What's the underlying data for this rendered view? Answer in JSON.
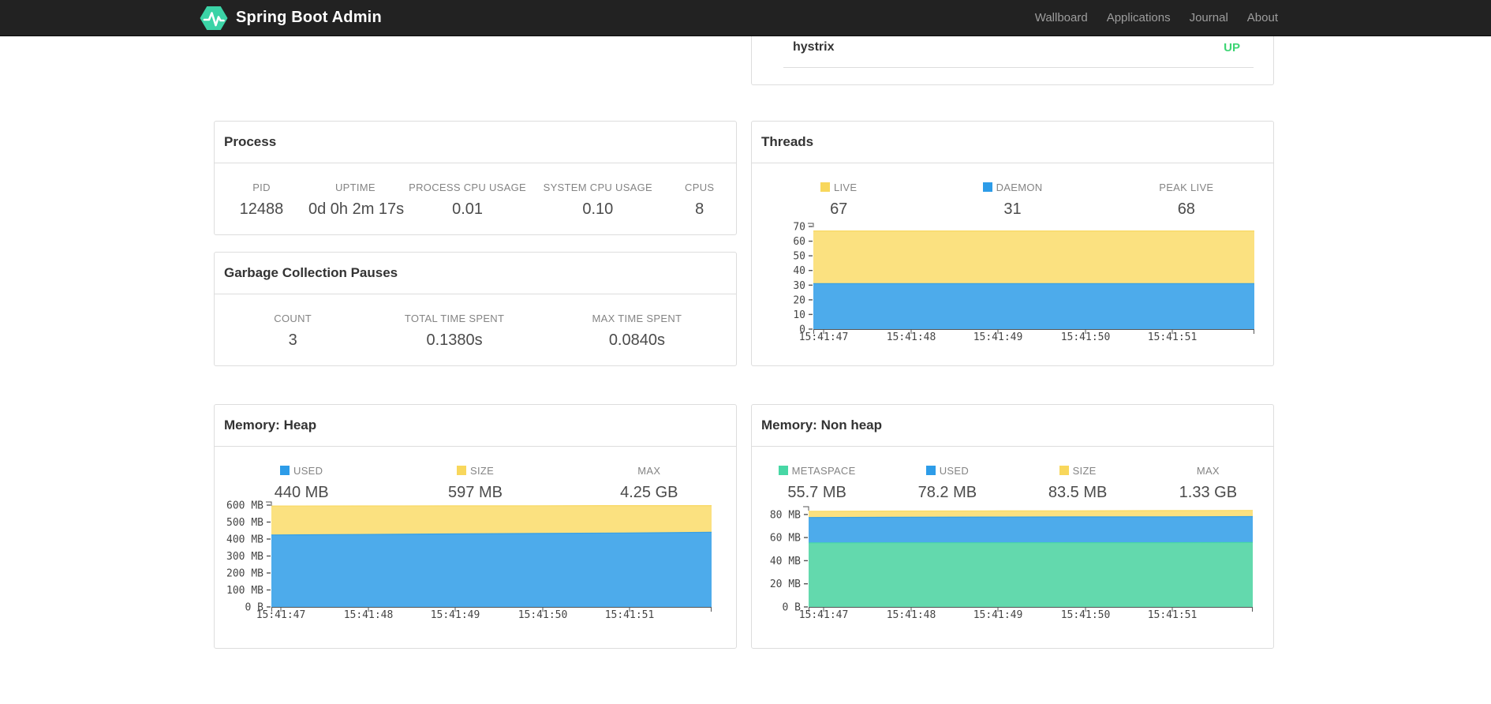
{
  "navbar": {
    "brand": "Spring Boot Admin",
    "items": [
      {
        "label": "Wallboard"
      },
      {
        "label": "Applications"
      },
      {
        "label": "Journal"
      },
      {
        "label": "About"
      }
    ]
  },
  "colors": {
    "brand_green": "#3BD3A6",
    "status_up": "#3DD574",
    "series_yellow": "#F8D75C",
    "series_blue": "#2D9CE8",
    "series_green": "#47D7A5"
  },
  "status_card": {
    "application": "hystrix",
    "status": "UP"
  },
  "process": {
    "title": "Process",
    "metrics": [
      {
        "label": "PID",
        "value": "12488"
      },
      {
        "label": "UPTIME",
        "value": "0d 0h 2m 17s"
      },
      {
        "label": "PROCESS CPU USAGE",
        "value": "0.01"
      },
      {
        "label": "SYSTEM CPU USAGE",
        "value": "0.10"
      },
      {
        "label": "CPUS",
        "value": "8"
      }
    ]
  },
  "gc": {
    "title": "Garbage Collection Pauses",
    "metrics": [
      {
        "label": "COUNT",
        "value": "3"
      },
      {
        "label": "TOTAL TIME SPENT",
        "value": "0.1380s"
      },
      {
        "label": "MAX TIME SPENT",
        "value": "0.0840s"
      }
    ]
  },
  "threads": {
    "title": "Threads",
    "metrics": [
      {
        "label": "LIVE",
        "value": "67",
        "color": "#F8D75C"
      },
      {
        "label": "DAEMON",
        "value": "31",
        "color": "#2D9CE8"
      },
      {
        "label": "PEAK LIVE",
        "value": "68"
      }
    ]
  },
  "heap": {
    "title": "Memory: Heap",
    "metrics": [
      {
        "label": "USED",
        "value": "440 MB",
        "color": "#2D9CE8"
      },
      {
        "label": "SIZE",
        "value": "597 MB",
        "color": "#F8D75C"
      },
      {
        "label": "MAX",
        "value": "4.25 GB"
      }
    ]
  },
  "nonheap": {
    "title": "Memory: Non heap",
    "metrics": [
      {
        "label": "METASPACE",
        "value": "55.7 MB",
        "color": "#47D7A5"
      },
      {
        "label": "USED",
        "value": "78.2 MB",
        "color": "#2D9CE8"
      },
      {
        "label": "SIZE",
        "value": "83.5 MB",
        "color": "#F8D75C"
      },
      {
        "label": "MAX",
        "value": "1.33 GB"
      }
    ]
  },
  "chart_data": [
    {
      "id": "threads",
      "type": "area",
      "title": "Threads",
      "x_labels": [
        "15:41:47",
        "15:41:48",
        "15:41:49",
        "15:41:50",
        "15:41:51"
      ],
      "ymax": 70,
      "yticks": [
        [
          70,
          "70"
        ],
        [
          60,
          "60"
        ],
        [
          50,
          "50"
        ],
        [
          40,
          "40"
        ],
        [
          30,
          "30"
        ],
        [
          20,
          "20"
        ],
        [
          10,
          "10"
        ],
        [
          0,
          "0"
        ]
      ],
      "legend_position": "top",
      "grid": false,
      "series": [
        {
          "name": "LIVE",
          "color": "#F8D75C",
          "fill": "#FBE180",
          "values": [
            67,
            67,
            67,
            67,
            67,
            67
          ]
        },
        {
          "name": "DAEMON",
          "color": "#2D9CE8",
          "fill": "#4DABEB",
          "values": [
            31,
            31,
            31,
            31,
            31,
            31
          ]
        }
      ]
    },
    {
      "id": "heap",
      "type": "area",
      "title": "Memory: Heap",
      "x_labels": [
        "15:41:47",
        "15:41:48",
        "15:41:49",
        "15:41:50",
        "15:41:51"
      ],
      "ymax": 600,
      "yticks": [
        [
          600,
          "600 MB"
        ],
        [
          500,
          "500 MB"
        ],
        [
          400,
          "400 MB"
        ],
        [
          300,
          "300 MB"
        ],
        [
          200,
          "200 MB"
        ],
        [
          100,
          "100 MB"
        ],
        [
          0,
          "0 B"
        ]
      ],
      "legend_position": "top",
      "grid": false,
      "series": [
        {
          "name": "SIZE",
          "color": "#F8D75C",
          "fill": "#FBE180",
          "values": [
            595,
            595.5,
            596,
            596.5,
            597,
            597
          ]
        },
        {
          "name": "USED",
          "color": "#2D9CE8",
          "fill": "#4DABEB",
          "values": [
            424,
            427,
            430,
            433,
            436,
            440
          ]
        }
      ]
    },
    {
      "id": "nonheap",
      "type": "area",
      "title": "Memory: Non heap",
      "x_labels": [
        "15:41:47",
        "15:41:48",
        "15:41:49",
        "15:41:50",
        "15:41:51"
      ],
      "ymax": 84,
      "yticks": [
        [
          80,
          "80 MB"
        ],
        [
          60,
          "60 MB"
        ],
        [
          40,
          "40 MB"
        ],
        [
          20,
          "20 MB"
        ],
        [
          0,
          "0 B"
        ]
      ],
      "legend_position": "top",
      "grid": false,
      "series": [
        {
          "name": "SIZE",
          "color": "#F8D75C",
          "fill": "#FBE180",
          "values": [
            82.8,
            83.0,
            83.1,
            83.2,
            83.4,
            83.5
          ]
        },
        {
          "name": "USED",
          "color": "#2D9CE8",
          "fill": "#4DABEB",
          "values": [
            77.4,
            77.6,
            77.8,
            77.9,
            78.0,
            78.2
          ]
        },
        {
          "name": "METASPACE",
          "color": "#47D7A5",
          "fill": "#63D9AD",
          "values": [
            55.4,
            55.5,
            55.5,
            55.6,
            55.6,
            55.7
          ]
        }
      ]
    }
  ]
}
